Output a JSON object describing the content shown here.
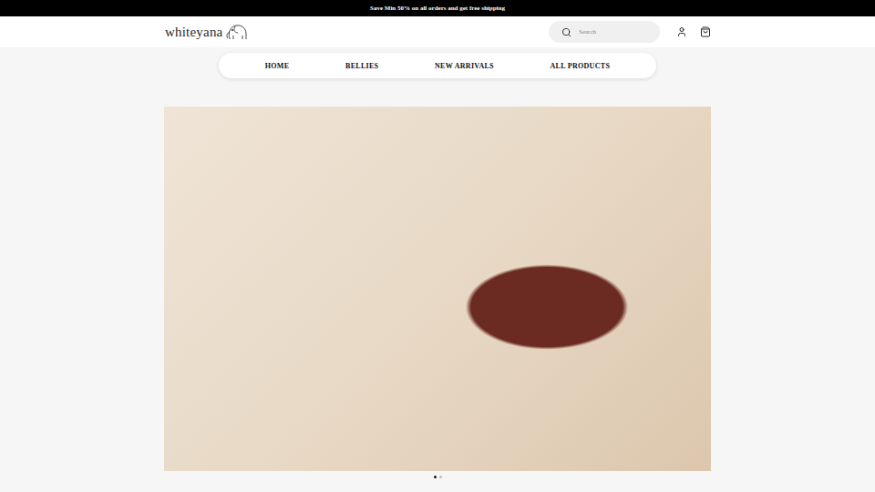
{
  "announcement": {
    "text": "Save Min 50% on all orders and get free shipping"
  },
  "logo": {
    "name": "whiteyana"
  },
  "search": {
    "placeholder": "Search"
  },
  "nav": {
    "items": [
      {
        "label": "HOME"
      },
      {
        "label": "BELLIES"
      },
      {
        "label": "NEW ARRIVALS"
      },
      {
        "label": "ALL PRODUCTS"
      }
    ]
  },
  "carousel": {
    "dots": [
      {
        "selected": true
      },
      {
        "selected": false
      }
    ]
  }
}
